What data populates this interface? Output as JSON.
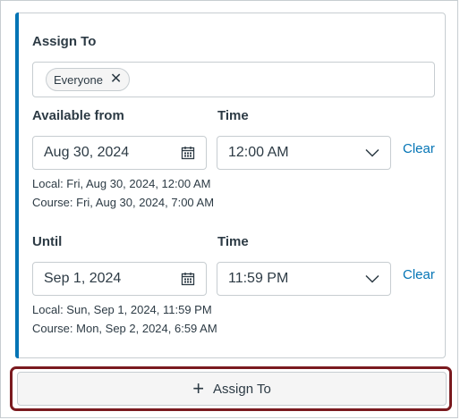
{
  "assign": {
    "label": "Assign To",
    "chips": [
      {
        "label": "Everyone"
      }
    ]
  },
  "available_from": {
    "label": "Available from",
    "date": "Aug 30, 2024",
    "time_label": "Time",
    "time": "12:00 AM",
    "clear": "Clear",
    "local": "Local: Fri, Aug 30, 2024, 12:00 AM",
    "course": "Course: Fri, Aug 30, 2024, 7:00 AM"
  },
  "until": {
    "label": "Until",
    "date": "Sep 1, 2024",
    "time_label": "Time",
    "time": "11:59 PM",
    "clear": "Clear",
    "local": "Local: Sun, Sep 1, 2024, 11:59 PM",
    "course": "Course: Mon, Sep 2, 2024, 6:59 AM"
  },
  "footer": {
    "add_button": "Assign To"
  },
  "colors": {
    "accent": "#0374b5",
    "focus_ring": "#7a1a1f"
  }
}
